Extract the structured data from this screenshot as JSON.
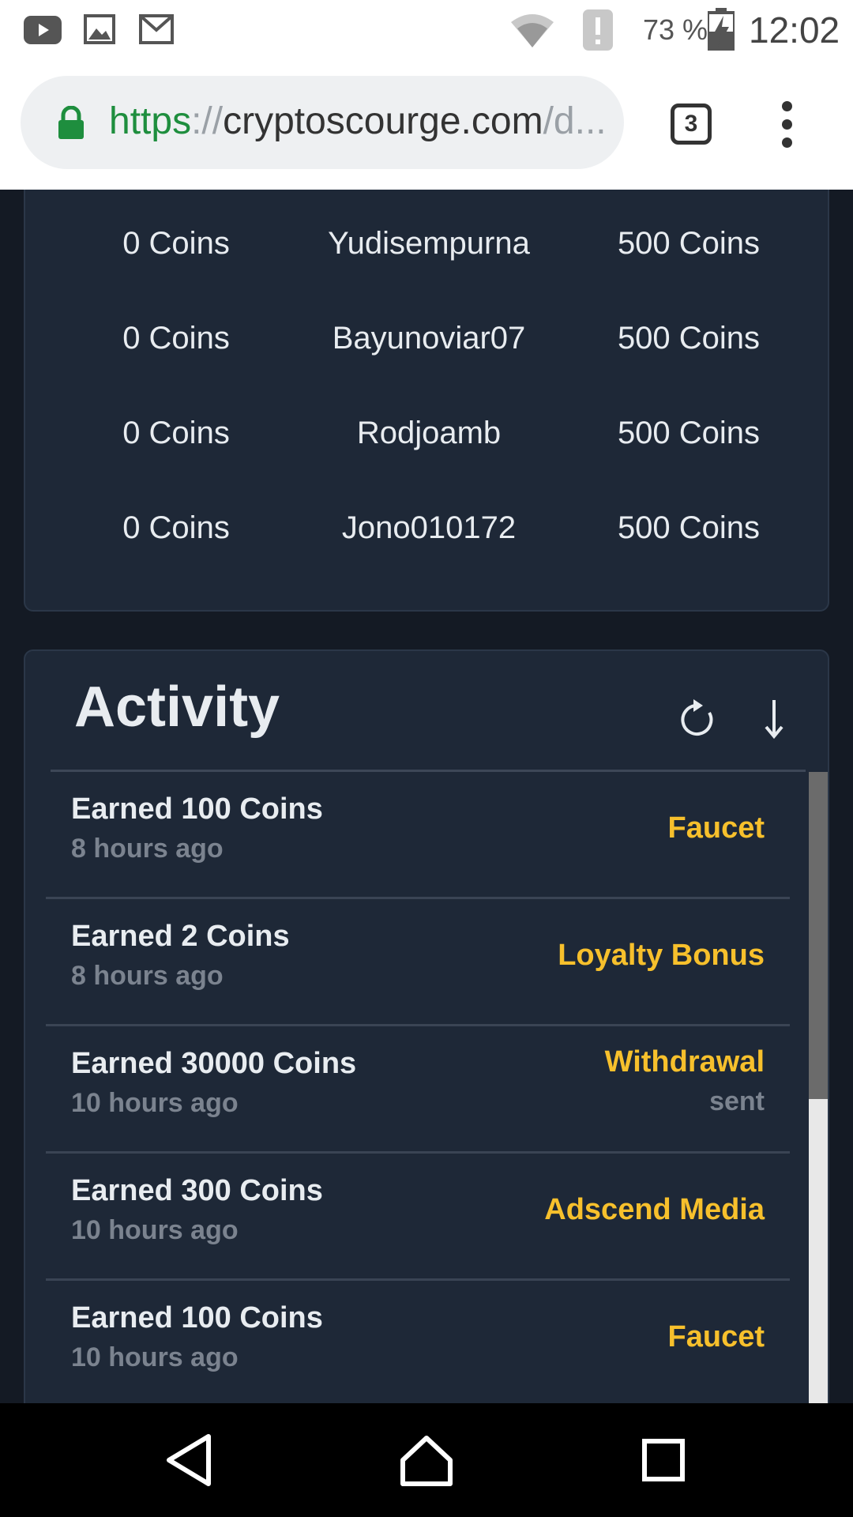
{
  "status_bar": {
    "battery": "73 %",
    "time": "12:02",
    "icons": [
      "youtube-icon",
      "image-icon",
      "gmail-icon",
      "wifi-icon",
      "alert-icon",
      "battery-charging-icon"
    ]
  },
  "browser": {
    "url_scheme": "https",
    "url_sep": "://",
    "url_host": "cryptoscourge.com",
    "url_path": "/d...",
    "tab_count": "3"
  },
  "leaderboard": {
    "rows": [
      {
        "left": "0 Coins",
        "name": "Yudisempurna",
        "right": "500 Coins"
      },
      {
        "left": "0 Coins",
        "name": "Bayunoviar07",
        "right": "500 Coins"
      },
      {
        "left": "0 Coins",
        "name": "Rodjoamb",
        "right": "500 Coins"
      },
      {
        "left": "0 Coins",
        "name": "Jono010172",
        "right": "500 Coins"
      }
    ]
  },
  "activity": {
    "title": "Activity",
    "items": [
      {
        "title": "Earned 100 Coins",
        "time": "8 hours ago",
        "source": "Faucet",
        "status": ""
      },
      {
        "title": "Earned 2 Coins",
        "time": "8 hours ago",
        "source": "Loyalty Bonus",
        "status": ""
      },
      {
        "title": "Earned 30000 Coins",
        "time": "10 hours ago",
        "source": "Withdrawal",
        "status": "sent"
      },
      {
        "title": "Earned 300 Coins",
        "time": "10 hours ago",
        "source": "Adscend Media",
        "status": ""
      },
      {
        "title": "Earned 100 Coins",
        "time": "10 hours ago",
        "source": "Faucet",
        "status": ""
      }
    ],
    "scroll_fraction": 0.5
  },
  "colors": {
    "page_bg": "#141a24",
    "card_bg": "#1e2837",
    "accent": "#f7c02c",
    "url_green": "#1e8e3e"
  }
}
